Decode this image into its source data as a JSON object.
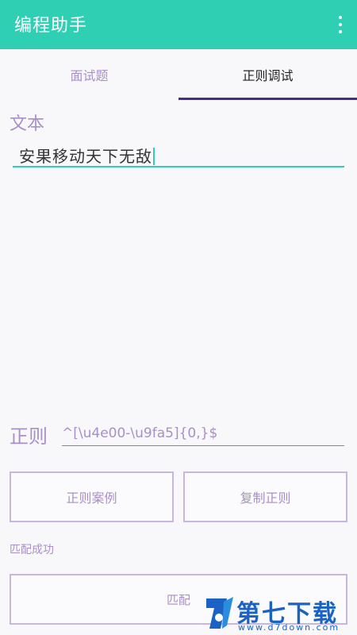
{
  "app": {
    "title": "编程助手",
    "menu_icon": "more-vert-icon"
  },
  "tabs": [
    {
      "label": "面试题",
      "active": false
    },
    {
      "label": "正则调试",
      "active": true
    }
  ],
  "text_field": {
    "label": "文本",
    "value": "安果移动天下无敌"
  },
  "regex_field": {
    "label": "正则",
    "value": "^[\\u4e00-\\u9fa5]{0,}$"
  },
  "buttons": {
    "example": "正则案例",
    "copy": "复制正则",
    "match": "匹配"
  },
  "status": "匹配成功",
  "watermark": {
    "title": "第七下载站",
    "url": "www.d7down.com"
  },
  "colors": {
    "primary": "#2fcfb4",
    "accent": "#a98fc8",
    "indicator": "#4a2a8c"
  }
}
